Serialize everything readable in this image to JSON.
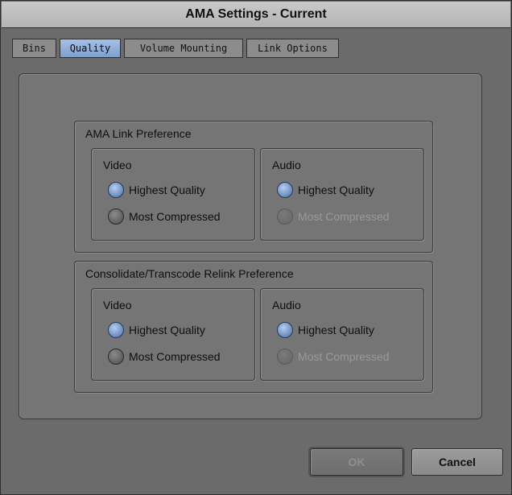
{
  "window": {
    "title": "AMA Settings - Current"
  },
  "tabs": [
    {
      "label": "Bins",
      "active": false
    },
    {
      "label": "Quality",
      "active": true
    },
    {
      "label": "Volume Mounting",
      "active": false
    },
    {
      "label": "Link Options",
      "active": false
    }
  ],
  "groups": [
    {
      "title": "AMA Link Preference",
      "video": {
        "label": "Video",
        "options": [
          {
            "label": "Highest Quality",
            "checked": true,
            "enabled": true
          },
          {
            "label": "Most Compressed",
            "checked": false,
            "enabled": true
          }
        ]
      },
      "audio": {
        "label": "Audio",
        "options": [
          {
            "label": "Highest Quality",
            "checked": true,
            "enabled": true
          },
          {
            "label": "Most Compressed",
            "checked": false,
            "enabled": false
          }
        ]
      }
    },
    {
      "title": "Consolidate/Transcode Relink Preference",
      "video": {
        "label": "Video",
        "options": [
          {
            "label": "Highest Quality",
            "checked": true,
            "enabled": true
          },
          {
            "label": "Most Compressed",
            "checked": false,
            "enabled": true
          }
        ]
      },
      "audio": {
        "label": "Audio",
        "options": [
          {
            "label": "Highest Quality",
            "checked": true,
            "enabled": true
          },
          {
            "label": "Most Compressed",
            "checked": false,
            "enabled": false
          }
        ]
      }
    }
  ],
  "buttons": {
    "ok_label": "OK",
    "ok_enabled": false,
    "cancel_label": "Cancel"
  },
  "colors": {
    "selected_accent": "#7f9fcc",
    "background": "#6b6b6b"
  }
}
